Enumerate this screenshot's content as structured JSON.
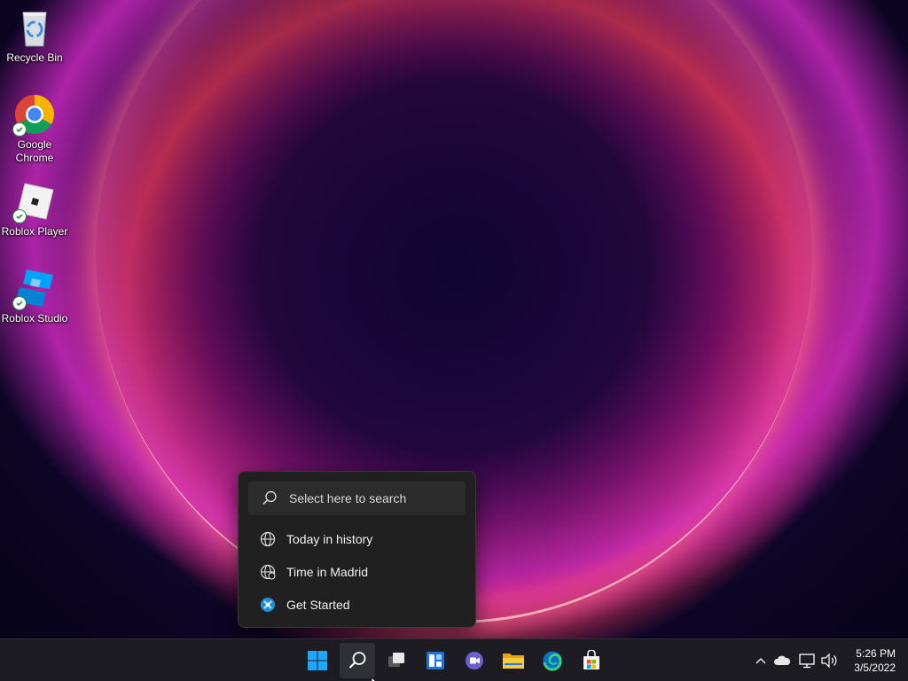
{
  "desktop": {
    "icons": [
      {
        "label": "Recycle Bin",
        "icon": "recycle-bin-icon"
      },
      {
        "label": "Google Chrome",
        "icon": "chrome-icon"
      },
      {
        "label": "Roblox Player",
        "icon": "roblox-player-icon"
      },
      {
        "label": "Roblox Studio",
        "icon": "roblox-studio-icon"
      }
    ]
  },
  "search_flyout": {
    "placeholder": "Select here to search",
    "items": [
      {
        "label": "Today in history",
        "icon": "globe-icon"
      },
      {
        "label": "Time in Madrid",
        "icon": "globe-clock-icon"
      },
      {
        "label": "Get Started",
        "icon": "get-started-icon"
      }
    ]
  },
  "taskbar": {
    "buttons": [
      {
        "name": "start",
        "icon": "windows-start-icon"
      },
      {
        "name": "search",
        "icon": "search-icon",
        "active": true
      },
      {
        "name": "task-view",
        "icon": "task-view-icon"
      },
      {
        "name": "widgets",
        "icon": "widgets-icon"
      },
      {
        "name": "teams-chat",
        "icon": "teams-chat-icon"
      },
      {
        "name": "file-explorer",
        "icon": "folder-icon"
      },
      {
        "name": "edge",
        "icon": "edge-icon"
      },
      {
        "name": "store",
        "icon": "store-icon"
      }
    ],
    "tray": {
      "icons": [
        "chevron-up-icon",
        "onedrive-cloud-icon",
        "network-icon",
        "volume-icon"
      ],
      "time": "5:26 PM",
      "date": "3/5/2022"
    }
  },
  "colors": {
    "taskbar_bg": "#1c1c22",
    "flyout_bg": "#202020",
    "accent_blue": "#0a84e0"
  }
}
